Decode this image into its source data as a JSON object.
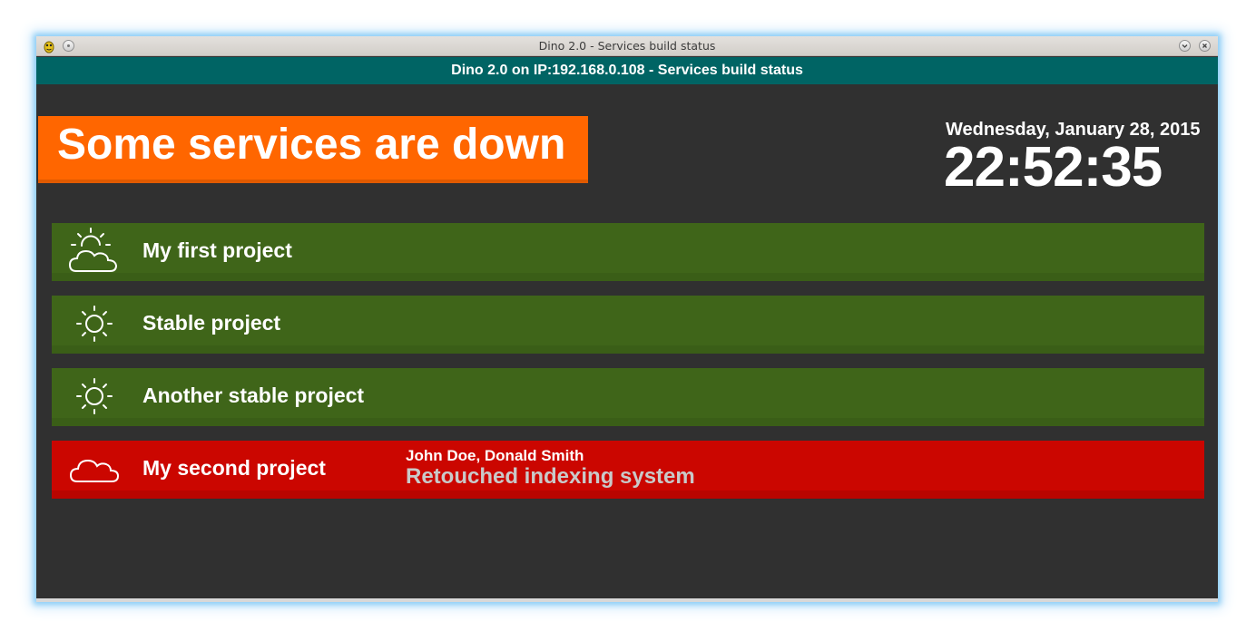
{
  "window": {
    "title": "Dino 2.0 - Services build status"
  },
  "header": {
    "title": "Dino 2.0 on IP:192.168.0.108 - Services build status"
  },
  "status": {
    "banner_text": "Some services are down",
    "banner_color": "#ff6600"
  },
  "clock": {
    "date": "Wednesday, January 28, 2015",
    "time": "22:52:35"
  },
  "colors": {
    "ok": "#3f6519",
    "fail": "#cb0600",
    "header": "#006464",
    "background": "#303030"
  },
  "projects": [
    {
      "name": "My first project",
      "state": "ok",
      "icon": "partly-cloudy-icon"
    },
    {
      "name": "Stable project",
      "state": "ok",
      "icon": "sun-icon"
    },
    {
      "name": "Another stable project",
      "state": "ok",
      "icon": "sun-icon"
    },
    {
      "name": "My second project",
      "state": "fail",
      "icon": "cloud-icon",
      "authors": "John Doe, Donald Smith",
      "message": "Retouched indexing system"
    }
  ]
}
